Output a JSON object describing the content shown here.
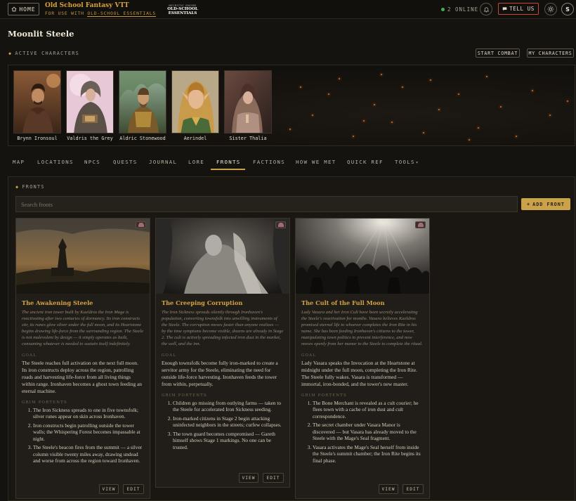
{
  "topbar": {
    "home_label": "HOME",
    "brand_title": "Old School Fantasy VTT",
    "brand_sub_prefix": "FOR USE WITH ",
    "brand_sub_link": "OLD-SCHOOL ESSENTIALS",
    "ose_logo_small": "NECROTIC GNOME",
    "ose_logo_big": "OLD-SCHOOL ESSENTIALS",
    "online_text": "2 ONLINE",
    "tell_us_label": "TELL US",
    "avatar_initial": "S"
  },
  "campaign": {
    "title": "Moonlit Steele",
    "active_label": "ACTIVE CHARACTERS",
    "start_combat": "START COMBAT",
    "my_characters": "MY CHARACTERS"
  },
  "characters": [
    {
      "name": "Brynn Ironsoul"
    },
    {
      "name": "Valdris the Grey"
    },
    {
      "name": "Aldric Stonewood"
    },
    {
      "name": "Aerindel"
    },
    {
      "name": "Sister Thalia"
    }
  ],
  "tabs": [
    "MAP",
    "LOCATIONS",
    "NPCS",
    "QUESTS",
    "JOURNAL",
    "LORE",
    "FRONTS",
    "FACTIONS",
    "HOW WE MET",
    "QUICK REF",
    "TOOLS"
  ],
  "active_tab": "FRONTS",
  "fronts": {
    "label": "FRONTS",
    "search_placeholder": "Search fronts",
    "add_label": "ADD FRONT",
    "goal_label": "GOAL",
    "portents_label": "GRIM PORTENTS",
    "view_label": "VIEW",
    "edit_label": "EDIT",
    "cards": [
      {
        "title": "The Awakening Steele",
        "description": "The ancient iron tower built by Kaeldros the Iron Mage is reactivating after two centuries of dormancy. Its iron constructs stir, its runes glow silver under the full moon, and its Heartstone begins drawing life-force from the surrounding region. The Steele is not malevolent by design — it simply operates as built, consuming whatever is needed to sustain itself indefinitely.",
        "goal": "The Steele reaches full activation on the next full moon. Its iron constructs deploy across the region, patrolling roads and harvesting life-force from all living things within range. Ironhaven becomes a ghost town feeding an eternal machine.",
        "portents": [
          "The Iron Sickness spreads to one in five townsfolk; silver runes appear on skin across Ironhaven.",
          "Iron constructs begin patrolling outside the tower walls; the Whispering Forest becomes impassable at night.",
          "The Steele's beacon fires from the summit — a silver column visible twenty miles away, drawing undead and worse from across the region toward Ironhaven."
        ]
      },
      {
        "title": "The Creeping Corruption",
        "description": "The Iron Sickness spreads silently through Ironhaven's population, converting townsfolk into unwilling instruments of the Steele. The corruption moves faster than anyone realizes — by the time symptoms become visible, dozens are already in Stage 2. The cult is actively spreading infected iron dust in the market, the well, and the inn.",
        "goal": "Enough townsfolk become fully iron-marked to create a servitor army for the Steele, eliminating the need for outside life-force harvesting. Ironhaven feeds the tower from within, perpetually.",
        "portents": [
          "Children go missing from outlying farms — taken to the Steele for accelerated Iron Sickness seeding.",
          "Iron-marked citizens in Stage 2 begin attacking uninfected neighbors in the streets; curfew collapses.",
          "The town guard becomes compromised — Gareth himself shows Stage 1 markings. No one can be trusted."
        ]
      },
      {
        "title": "The Cult of the Full Moon",
        "description": "Lady Vasara and her Iron Cult have been secretly accelerating the Steele's reactivation for months. Vasara believes Kaeldros promised eternal life to whoever completes the Iron Rite in his name. She has been feeding Ironhaven's citizens to the tower, manipulating town politics to prevent interference, and now moves openly from her manor to the Steele to complete the ritual.",
        "goal": "Lady Vasara speaks the Invocation at the Heartstone at midnight under the full moon, completing the Iron Rite. The Steele fully wakes. Vasara is transformed — immortal, iron-bonded, and the tower's new master.",
        "portents": [
          "The Bone Merchant is revealed as a cult courier; he flees town with a cache of iron dust and cult correspondence.",
          "The secret chamber under Vasara Manor is discovered — but Vasara has already moved to the Steele with the Mage's Seal fragment.",
          "Vasara activates the Mage's Seal herself from inside the Steele's summit chamber; the Iron Rite begins its final phase."
        ]
      }
    ]
  },
  "colors": {
    "accent_gold": "#c9a24a",
    "title_gold": "#d2a545",
    "tell_us_red": "#c44b3c",
    "online_green": "#3fb24f"
  },
  "icons": [
    "home-icon",
    "bell-icon",
    "chat-icon",
    "sun-icon",
    "diamond-icon",
    "plus-icon",
    "image-badge-icon",
    "chevron-down-icon"
  ]
}
